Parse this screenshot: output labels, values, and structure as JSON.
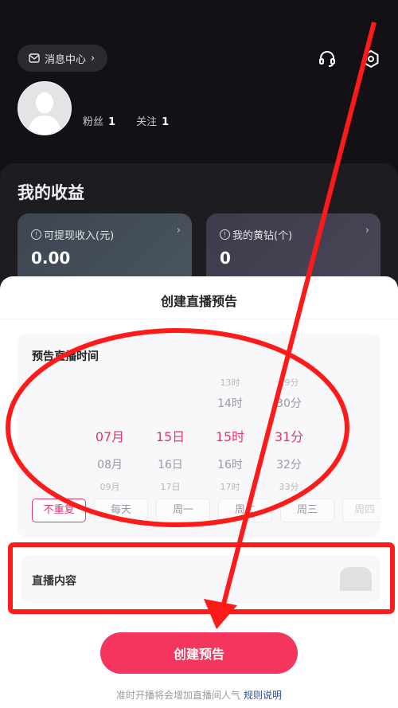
{
  "header": {
    "message_center_label": "消息中心",
    "stats": [
      {
        "label": "粉丝",
        "value": "1"
      },
      {
        "label": "关注",
        "value": "1"
      }
    ],
    "icons": [
      "headset-icon",
      "settings-icon"
    ]
  },
  "earnings": {
    "title": "我的收益",
    "cards": [
      {
        "label": "可提现收入(元)",
        "value": "0.00"
      },
      {
        "label": "我的黄钻(个)",
        "value": "0"
      }
    ]
  },
  "sheet": {
    "title": "创建直播预告",
    "time_section_label": "预告直播时间",
    "picker": {
      "months": [
        "07月",
        "08月",
        "09月"
      ],
      "days": [
        "15日",
        "16日",
        "17日"
      ],
      "hours": [
        "13时",
        "14时",
        "15时",
        "16时",
        "17时"
      ],
      "minutes": [
        "29分",
        "30分",
        "31分",
        "32分",
        "33分"
      ],
      "selected": {
        "month": "07月",
        "day": "15日",
        "hour": "15时",
        "minute": "31分"
      }
    },
    "repeat_options": [
      "不重复",
      "每天",
      "周一",
      "周二",
      "周三",
      "周四"
    ],
    "repeat_selected": "不重复",
    "content_section_label": "直播内容",
    "create_button_label": "创建预告",
    "footnote_text": "准时开播将会增加直播间人气",
    "footnote_link": "规则说明"
  },
  "colors": {
    "accent": "#f4355e",
    "selected_text": "#e8336f",
    "link": "#2c4a8a",
    "annotation_red": "#ff1a1a"
  }
}
